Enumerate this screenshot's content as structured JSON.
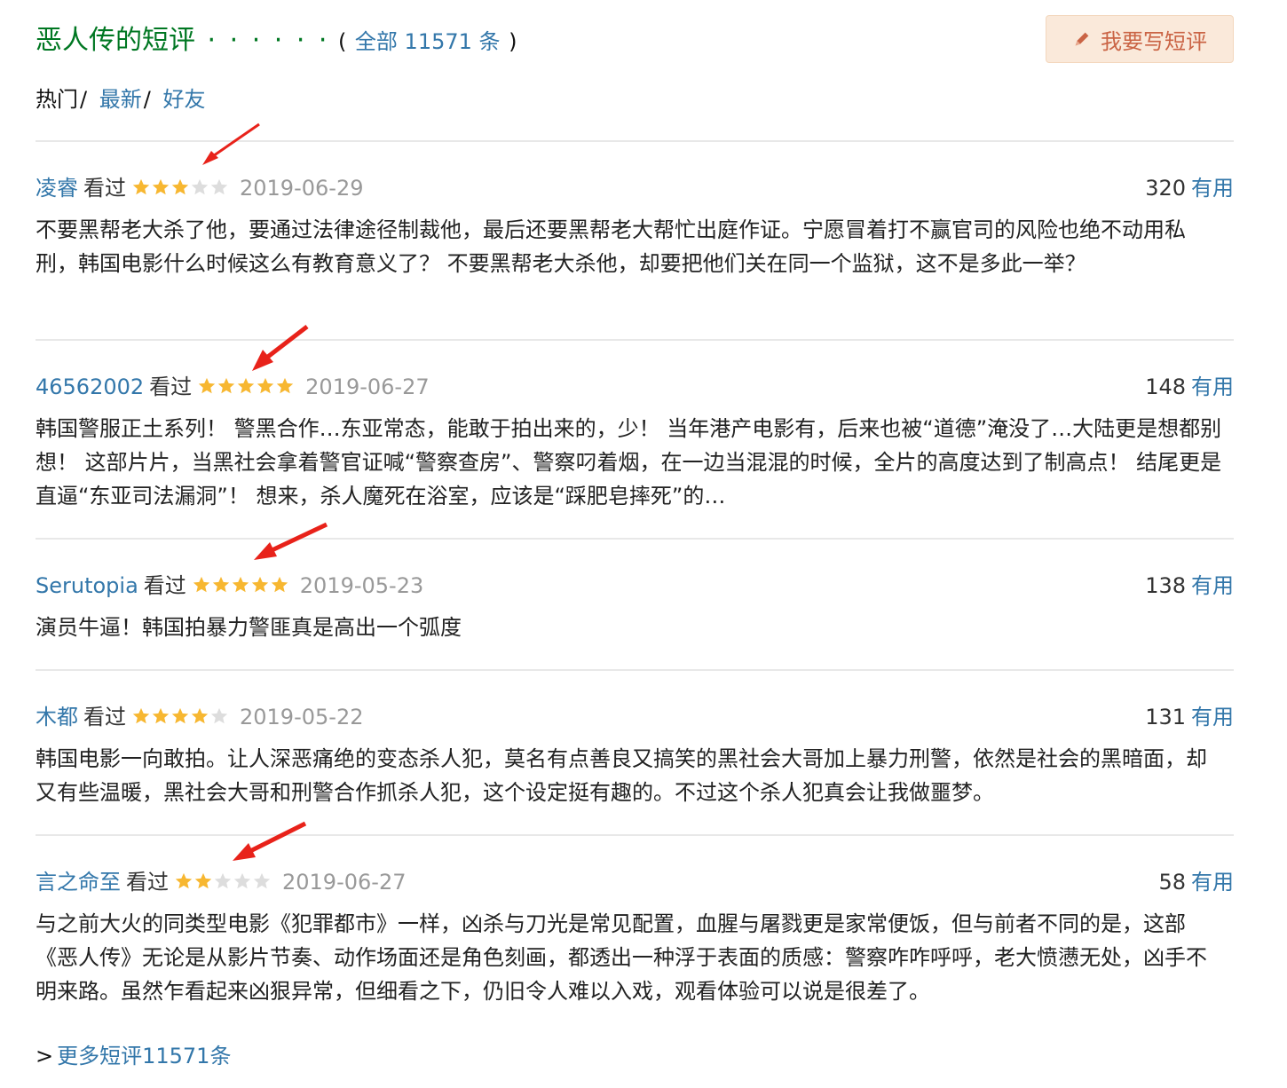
{
  "header": {
    "title": "恶人传的短评",
    "dots": "· · · · · ·",
    "paren_open": "(",
    "all_link": "全部 11571 条",
    "paren_close": ")",
    "write_button": "我要写短评"
  },
  "tabs": {
    "hot": "热门",
    "sep1": "/",
    "latest": "最新",
    "sep2": "/",
    "friends": "好友"
  },
  "colors": {
    "link": "#3377aa",
    "title_green": "#007722",
    "star_on": "#f7b731",
    "star_off": "#dddddd",
    "arrow_red": "#e8221a",
    "button_bg": "#fae9da",
    "button_text": "#ca6445"
  },
  "comments": [
    {
      "user": "凌睿",
      "status": "看过",
      "rating": 3,
      "date": "2019-06-29",
      "votes": "320",
      "vote_label": "有用",
      "text": "不要黑帮老大杀了他，要通过法律途径制裁他，最后还要黑帮老大帮忙出庭作证。宁愿冒着打不赢官司的风险也绝不动用私刑，韩国电影什么时候这么有教育意义了？ 不要黑帮老大杀他，却要把他们关在同一个监狱，这不是多此一举？"
    },
    {
      "user": "46562002",
      "status": "看过",
      "rating": 5,
      "date": "2019-06-27",
      "votes": "148",
      "vote_label": "有用",
      "text": "韩国警服正土系列！ 警黑合作…东亚常态，能敢于拍出来的，少！ 当年港产电影有，后来也被“道德”淹没了…大陆更是想都别想！ 这部片片，当黑社会拿着警官证喊“警察查房”、警察叼着烟，在一边当混混的时候，全片的高度达到了制高点！ 结尾更是直逼“东亚司法漏洞”！ 想来，杀人魔死在浴室，应该是“踩肥皂摔死”的…"
    },
    {
      "user": "Serutopia",
      "status": "看过",
      "rating": 5,
      "date": "2019-05-23",
      "votes": "138",
      "vote_label": "有用",
      "text": "演员牛逼！韩国拍暴力警匪真是高出一个弧度"
    },
    {
      "user": "木都",
      "status": "看过",
      "rating": 4,
      "date": "2019-05-22",
      "votes": "131",
      "vote_label": "有用",
      "text": "韩国电影一向敢拍。让人深恶痛绝的变态杀人犯，莫名有点善良又搞笑的黑社会大哥加上暴力刑警，依然是社会的黑暗面，却又有些温暖，黑社会大哥和刑警合作抓杀人犯，这个设定挺有趣的。不过这个杀人犯真会让我做噩梦。"
    },
    {
      "user": "言之命至",
      "status": "看过",
      "rating": 2,
      "date": "2019-06-27",
      "votes": "58",
      "vote_label": "有用",
      "text": "与之前大火的同类型电影《犯罪都市》一样，凶杀与刀光是常见配置，血腥与屠戮更是家常便饭，但与前者不同的是，这部《恶人传》无论是从影片节奏、动作场面还是角色刻画，都透出一种浮于表面的质感：警察咋咋呼呼，老大愤懑无处，凶手不明来路。虽然乍看起来凶狠异常，但细看之下，仍旧令人难以入戏，观看体验可以说是很差了。"
    }
  ],
  "more": {
    "gt": ">",
    "link": "更多短评11571条"
  }
}
